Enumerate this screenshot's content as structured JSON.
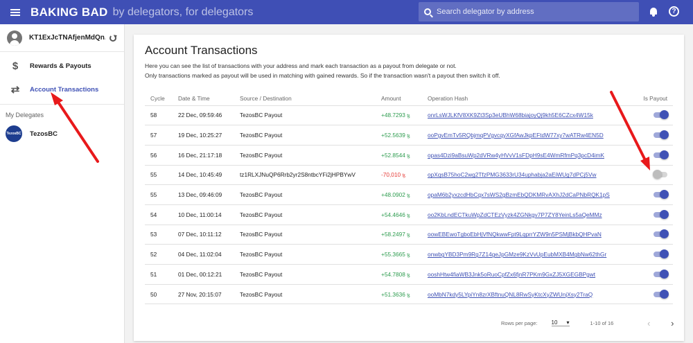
{
  "app": {
    "title": "BAKING BAD",
    "tagline": "by delegators, for delegators",
    "search_placeholder": "Search delegator by address",
    "bell_icon": "bell-icon",
    "help_icon": "help-icon",
    "help_glyph": "?"
  },
  "sidebar": {
    "account_address": "KT1ExJcTNAfjenMdQn...",
    "nav": [
      {
        "label": "Rewards & Payouts",
        "icon": "dollar-icon",
        "glyph": "$"
      },
      {
        "label": "Account Transactions",
        "icon": "swap-arrows-icon",
        "glyph": "⇄"
      }
    ],
    "delegates_header": "My Delegates",
    "delegates": [
      {
        "name": "TezosBC",
        "logo_text": "TezosBC"
      }
    ]
  },
  "main": {
    "title": "Account Transactions",
    "description_line1": "Here you can see the list of transactions with your address and mark each transaction as a payout from delegate or not.",
    "description_line2": "Only transactions marked as payout will be used in matching with gained rewards. So if the transaction wasn't a payout then switch it off.",
    "columns": [
      "Cycle",
      "Date & Time",
      "Source / Destination",
      "Amount",
      "Operation Hash",
      "Is Payout"
    ],
    "rows": [
      {
        "cycle": "58",
        "date": "22 Dec, 09:59:46",
        "source": "TezosBC Payout",
        "amount": "+48.7293",
        "hash": "onrLsWJLKfV8XK9Zt3Sp3eUBhW68biajoyQj9kh5E6CZcx4W15k",
        "is_payout": true
      },
      {
        "cycle": "57",
        "date": "19 Dec, 10:25:27",
        "source": "TezosBC Payout",
        "amount": "+52.5639",
        "hash": "ooPgvEmTv5RQbjmqPVgvcqyXGfAwJkpEFtdW77xy7wATRw4EN5D",
        "is_payout": true
      },
      {
        "cycle": "56",
        "date": "16 Dec, 21:17:18",
        "source": "TezosBC Payout",
        "amount": "+52.8544",
        "hash": "opas4Dzi9aBsuWp2dVRw4yHVvV1sFDpH9sE4WmRfmPq3pcD4imK",
        "is_payout": true
      },
      {
        "cycle": "55",
        "date": "14 Dec, 10:45:49",
        "source": "tz1RLXJNuQP6Rrb2yr2S8ntbcYFi2jHPBYwV",
        "amount": "-70,010",
        "hash": "opXqsB75hoC2wg2TfzPMG3633rU34uphabja2aEiWUg7dPCj5Vw",
        "is_payout": false
      },
      {
        "cycle": "55",
        "date": "13 Dec, 09:46:09",
        "source": "TezosBC Payout",
        "amount": "+48.0902",
        "hash": "opaM6b2yxzcdHbCqx7sWS2gBzmEbQDKMRvAXhJ2dCaPNbRQK1pS",
        "is_payout": true
      },
      {
        "cycle": "54",
        "date": "10 Dec, 11:00:14",
        "source": "TezosBC Payout",
        "amount": "+54.4646",
        "hash": "oo2KbLndECTkuWpZdCTEzVyzk4ZGNkgv7P7ZY8YeinLs5aQeMMz",
        "is_payout": true
      },
      {
        "cycle": "53",
        "date": "07 Dec, 10:11:12",
        "source": "TezosBC Payout",
        "amount": "+58.2497",
        "hash": "oowEBEwoTgboEbHjVfNQkwwFpt9LqprrYZW9n5PSMjBkbQHPvaN",
        "is_payout": true
      },
      {
        "cycle": "52",
        "date": "04 Dec, 11:02:04",
        "source": "TezosBC Payout",
        "amount": "+55.3665",
        "hash": "onwbgYBD3Pm9Rg7Z14geJpGMze9KzVvUpEubMXB4MgbNw62thGr",
        "is_payout": true
      },
      {
        "cycle": "51",
        "date": "01 Dec, 00:12:21",
        "source": "TezosBC Payout",
        "amount": "+54.7808",
        "hash": "ooshHtw4fiaWB3Jnk5oRuoCpfZx6fjnR7PKm9GxZJ5XGEGBPgwt",
        "is_payout": true
      },
      {
        "cycle": "50",
        "date": "27 Nov, 20:15:07",
        "source": "TezosBC Payout",
        "amount": "+51.3636",
        "hash": "ooMbN7kdy5LYpiYn8zrXBftnuQNL8RwSyKtcXyZWUnjXsy2TraQ",
        "is_payout": true
      }
    ],
    "currency_symbol": "ꜩ",
    "pagination": {
      "rows_per_page_label": "Rows per page:",
      "rows_per_page": "10",
      "range": "1-10 of 16",
      "prev_glyph": "‹",
      "next_glyph": "›"
    }
  },
  "annotation": {
    "arrow_color": "#e8191b"
  },
  "colors": {
    "primary": "#3f51b5",
    "appbar": "#3f4fb5",
    "positive": "#2e9c4f",
    "negative": "#e53935"
  }
}
